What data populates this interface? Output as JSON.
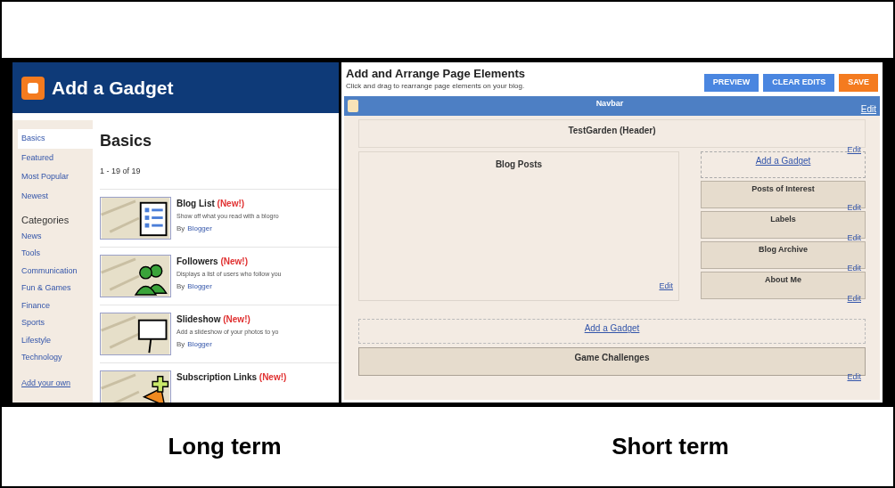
{
  "left_screen": {
    "title": "Add a Gadget",
    "sidebar": {
      "items": [
        {
          "label": "Basics",
          "selected": true
        },
        {
          "label": "Featured",
          "selected": false
        },
        {
          "label": "Most Popular",
          "selected": false
        },
        {
          "label": "Newest",
          "selected": false
        }
      ],
      "categories_heading": "Categories",
      "categories": [
        "News",
        "Tools",
        "Communication",
        "Fun & Games",
        "Finance",
        "Sports",
        "Lifestyle",
        "Technology"
      ],
      "footer_link": "Add your own"
    },
    "heading": "Basics",
    "count": "1 - 19 of 19",
    "gadgets": [
      {
        "name": "Blog List",
        "badge": "(New!)",
        "description": "Show off what you read with a blogro",
        "by": "By",
        "author": "Blogger",
        "kind": "list"
      },
      {
        "name": "Followers",
        "badge": "(New!)",
        "description": "Displays a list of users who follow you",
        "by": "By",
        "author": "Blogger",
        "kind": "people"
      },
      {
        "name": "Slideshow",
        "badge": "(New!)",
        "description": "Add a slideshow of your photos to yo",
        "by": "By",
        "author": "Blogger",
        "kind": "sign"
      },
      {
        "name": "Subscription Links",
        "badge": "(New!)",
        "kind": "plus"
      }
    ]
  },
  "right_screen": {
    "title": "Add and Arrange Page Elements",
    "subtitle": "Click and drag to rearrange page elements on your blog.",
    "buttons": [
      {
        "label": "PREVIEW",
        "kind": "secondary"
      },
      {
        "label": "CLEAR EDITS",
        "kind": "secondary"
      },
      {
        "label": "SAVE",
        "kind": "primary"
      }
    ],
    "navbar": {
      "label": "Navbar",
      "edit": "Edit"
    },
    "header": {
      "title": "TestGarden (Header)",
      "edit": "Edit"
    },
    "main": {
      "title": "Blog Posts",
      "edit": "Edit"
    },
    "sidebar": {
      "add_gadget": "Add a Gadget",
      "widgets": [
        {
          "title": "Posts of Interest",
          "edit": "Edit"
        },
        {
          "title": "Labels",
          "edit": "Edit"
        },
        {
          "title": "Blog Archive",
          "edit": "Edit"
        },
        {
          "title": "About Me",
          "edit": "Edit"
        }
      ]
    },
    "add_gadget": "Add a Gadget",
    "footer_widget": {
      "title": "Game Challenges",
      "edit": "Edit"
    }
  },
  "captions": [
    "Long term",
    "Short term"
  ]
}
